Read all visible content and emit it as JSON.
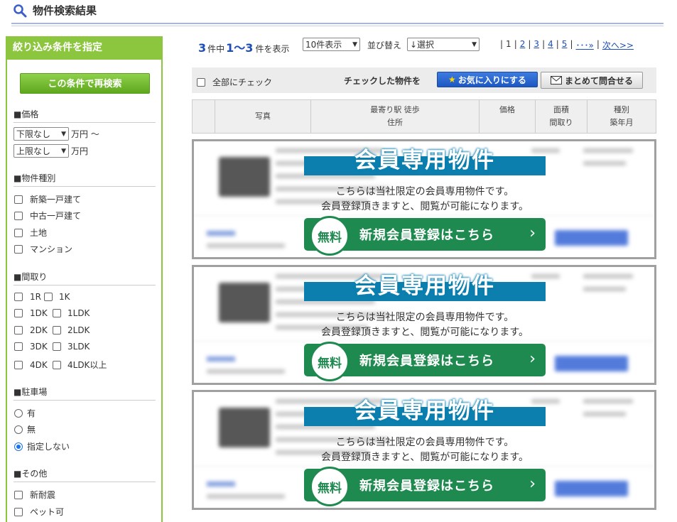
{
  "header": {
    "title": "物件検索結果"
  },
  "sidebar": {
    "title": "絞り込み条件を指定",
    "research_button": "この条件で再検索",
    "price": {
      "title": "■価格",
      "min_value": "下限なし",
      "max_value": "上限なし",
      "unit_from": "万円 ～",
      "unit_to": "万円"
    },
    "type": {
      "title": "■物件種別",
      "items": [
        "新築一戸建て",
        "中古一戸建て",
        "土地",
        "マンション"
      ]
    },
    "layout": {
      "title": "■間取り",
      "rows": [
        [
          "1R",
          "1K"
        ],
        [
          "1DK",
          "1LDK"
        ],
        [
          "2DK",
          "2LDK"
        ],
        [
          "3DK",
          "3LDK"
        ],
        [
          "4DK",
          "4LDK以上"
        ]
      ]
    },
    "parking": {
      "title": "■駐車場",
      "options": [
        "有",
        "無",
        "指定しない"
      ],
      "selected": "指定しない"
    },
    "other": {
      "title": "■その他",
      "items": [
        "新耐震",
        "ペット可"
      ]
    }
  },
  "results": {
    "total": "3",
    "total_suffix": "件中",
    "range": "1～3",
    "range_suffix": "件を表示",
    "per_page": "10件表示",
    "sort_label": "並び替え",
    "sort_value": "↓選択",
    "pager": {
      "current": "1",
      "pages": [
        "2",
        "3",
        "4",
        "5"
      ],
      "ellipsis": "･･･»",
      "next": "次へ>>"
    }
  },
  "actions": {
    "check_all": "全部にチェック",
    "checked_label": "チェックした物件を",
    "favorite_button": "お気に入りにする",
    "inquiry_button": "まとめて問合せる"
  },
  "table_headers": {
    "photo": "写真",
    "station": "最寄り駅 徒歩",
    "address": "住所",
    "price": "価格",
    "area": "面積",
    "layout": "間取り",
    "type": "種別",
    "built": "築年月"
  },
  "member_card": {
    "title": "会員専用物件",
    "note_line1": "こちらは当社限定の会員専用物件です。",
    "note_line2": "会員登録頂きますと、閲覧が可能になります。",
    "free_label": "無料",
    "register_label": "新規会員登録はこちら",
    "count": 3
  },
  "colors": {
    "accent_green": "#8cc63f",
    "link_blue": "#1e4db7",
    "member_blue": "#0c7fae",
    "register_green": "#1f8a4f"
  }
}
